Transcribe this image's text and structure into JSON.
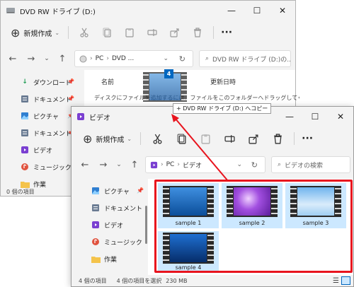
{
  "back_window": {
    "title": "DVD RW ドライブ (D:)",
    "toolbar": {
      "new_label": "新規作成"
    },
    "address": {
      "crumb1": "PC",
      "crumb2": "DVD ...",
      "sep": "›"
    },
    "search_placeholder": "DVD RW ドライブ (D:)の...",
    "columns": {
      "name": "名前",
      "modified": "更新日時"
    },
    "empty_message": "ディスクにファイルを追加するには、ファイルをこのフォルダーへドラッグしてください。",
    "sidebar": [
      {
        "label": "ダウンロード",
        "icon": "download-icon"
      },
      {
        "label": "ドキュメント",
        "icon": "documents-icon"
      },
      {
        "label": "ピクチャ",
        "icon": "pictures-icon"
      },
      {
        "label": "ドキュメント",
        "icon": "documents-icon"
      },
      {
        "label": "ビデオ",
        "icon": "videos-icon"
      },
      {
        "label": "ミュージック",
        "icon": "music-icon"
      },
      {
        "label": "作業",
        "icon": "folder-icon"
      }
    ],
    "status": "0 個の項目"
  },
  "drag": {
    "count": "4",
    "tooltip": "+ DVD RW ドライブ (D:) へコピー"
  },
  "front_window": {
    "title": "ビデオ",
    "toolbar": {
      "new_label": "新規作成"
    },
    "address": {
      "crumb1": "PC",
      "crumb2": "ビデオ",
      "sep": "›"
    },
    "search_placeholder": "ビデオの検索",
    "sidebar": [
      {
        "label": "ピクチャ",
        "icon": "pictures-icon"
      },
      {
        "label": "ドキュメント",
        "icon": "documents-icon"
      },
      {
        "label": "ビデオ",
        "icon": "videos-icon"
      },
      {
        "label": "ミュージック",
        "icon": "music-icon"
      },
      {
        "label": "作業",
        "icon": "folder-icon"
      }
    ],
    "files": [
      {
        "name": "sample 1",
        "selected": true
      },
      {
        "name": "sample 2",
        "selected": true
      },
      {
        "name": "sample 3",
        "selected": true
      },
      {
        "name": "sample 4",
        "selected": true
      }
    ],
    "status": {
      "count": "4 個の項目",
      "selected": "4 個の項目を選択",
      "size": "230 MB"
    }
  },
  "colors": {
    "selection": "#cce8ff",
    "accent": "#0067c0",
    "highlight": "#e8141e"
  }
}
